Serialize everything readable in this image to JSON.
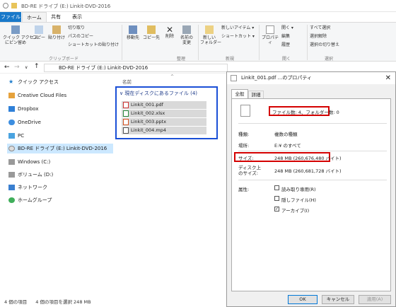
{
  "window": {
    "title": "BD-RE ドライブ (E:) Linkit-DVD-2016"
  },
  "tabs": {
    "file": "ファイル",
    "home": "ホーム",
    "share": "共有",
    "view": "表示"
  },
  "ribbon": {
    "pin": "クイック アクセス\nにピン留め",
    "copy": "コピー",
    "paste": "貼り付け",
    "cut": "切り取り",
    "copy_path": "パスのコピー",
    "paste_shortcut": "ショートカットの貼り付け",
    "clipboard": "クリップボード",
    "move_to": "移動先",
    "copy_to": "コピー先",
    "delete": "削除",
    "rename": "名前の\n変更",
    "organize": "整理",
    "new_folder": "新しい\nフォルダー",
    "new_item": "新しいアイテム ▾",
    "quick_access": "ショートカット ▾",
    "new": "新規",
    "properties": "プロパティ",
    "open": "開く ▾",
    "edit": "編集",
    "history": "履歴",
    "open_group": "開く",
    "select_all": "すべて選択",
    "select_none": "選択解除",
    "invert": "選択の切り替え",
    "select_group": "選択"
  },
  "address": {
    "path": "BD-RE ドライブ (E:) Linkit-DVD-2016"
  },
  "nav": {
    "items": [
      "クイック アクセス",
      "Creative Cloud Files",
      "Dropbox",
      "OneDrive",
      "PC",
      "BD-RE ドライブ (E:) Linkit-DVD-2016",
      "Windows (C:)",
      "ボリューム (D:)",
      "ネットワーク",
      "ホームグループ"
    ]
  },
  "content": {
    "column": "名前",
    "group": "現在ディスクにあるファイル (4)",
    "files": [
      "Linkit_001.pdf",
      "Linkit_002.xlsx",
      "Linkit_003.pptx",
      "Linkit_004.mp4"
    ]
  },
  "status": {
    "count": "4 個の項目",
    "selected": "4 個の項目を選択 248 MB"
  },
  "dialog": {
    "title": "Linkit_001.pdf ...のプロパティ",
    "tab_general": "全般",
    "tab_details": "詳細",
    "files_folders": "ファイル数: 4、フォルダー数: 0",
    "type_label": "種類:",
    "type_value": "複数の種類",
    "location_label": "場所:",
    "location_value": "E:¥ のすべて",
    "size_label": "サイズ:",
    "size_value": "248 MB (260,676,480 バイト)",
    "disk_label": "ディスク上\nのサイズ:",
    "disk_value": "248 MB (260,681,728 バイト)",
    "attr_label": "属性:",
    "readonly": "読み取り専用(R)",
    "hidden": "隠しファイル(H)",
    "archive": "アーカイブ(I)",
    "ok": "OK",
    "cancel": "キャンセル",
    "apply": "適用(A)"
  },
  "colors": {
    "accent": "#1979ca",
    "highlight_red": "#d40000",
    "highlight_blue": "#1a4fd6"
  }
}
